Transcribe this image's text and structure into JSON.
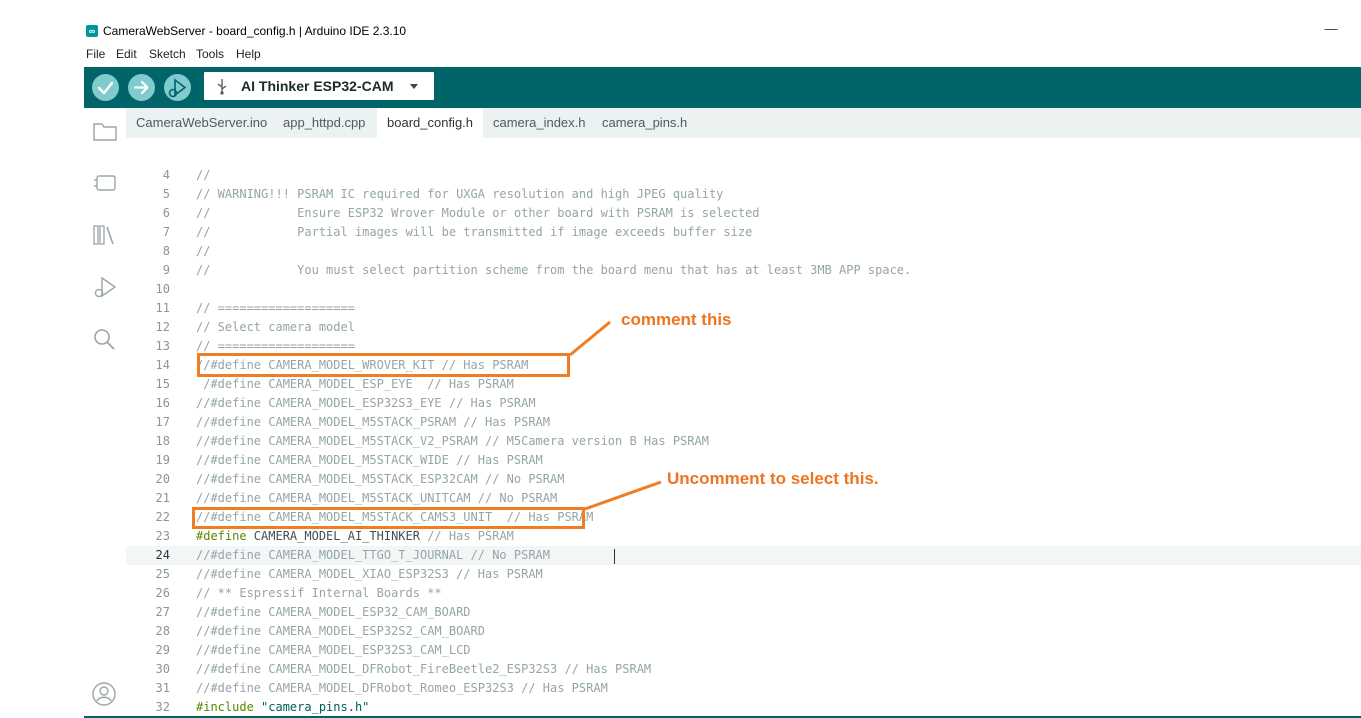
{
  "window": {
    "title": "CameraWebServer - board_config.h | Arduino IDE 2.3.10",
    "minimize_glyph": "—",
    "logo_text": "∞"
  },
  "menu": [
    "File",
    "Edit",
    "Sketch",
    "Tools",
    "Help"
  ],
  "toolbar": {
    "buttons": [
      "verify-button",
      "upload-button",
      "debug-button"
    ],
    "board_name": "AI Thinker ESP32-CAM"
  },
  "sidebar": [
    "folder-icon",
    "board-manager-icon",
    "library-icon",
    "debug-icon",
    "search-icon",
    "account-icon"
  ],
  "tabs": [
    {
      "label": "CameraWebServer.ino",
      "active": false
    },
    {
      "label": "app_httpd.cpp",
      "active": false
    },
    {
      "label": "board_config.h",
      "active": true
    },
    {
      "label": "camera_index.h",
      "active": false
    },
    {
      "label": "camera_pins.h",
      "active": false
    }
  ],
  "editor": {
    "current_line": 24,
    "lines": [
      {
        "n": "4",
        "parts": [
          [
            "c",
            "//"
          ]
        ]
      },
      {
        "n": "5",
        "parts": [
          [
            "c",
            "// WARNING!!! PSRAM IC required for UXGA resolution and high JPEG quality"
          ]
        ]
      },
      {
        "n": "6",
        "parts": [
          [
            "c",
            "//            Ensure ESP32 Wrover Module or other board with PSRAM is selected"
          ]
        ]
      },
      {
        "n": "7",
        "parts": [
          [
            "c",
            "//            Partial images will be transmitted if image exceeds buffer size"
          ]
        ]
      },
      {
        "n": "8",
        "parts": [
          [
            "c",
            "//"
          ]
        ]
      },
      {
        "n": "9",
        "parts": [
          [
            "c",
            "//            You must select partition scheme from the board menu that has at least 3MB APP space."
          ]
        ]
      },
      {
        "n": "10",
        "parts": []
      },
      {
        "n": "11",
        "parts": [
          [
            "c",
            "// ==================="
          ]
        ]
      },
      {
        "n": "12",
        "parts": [
          [
            "c",
            "// Select camera model"
          ]
        ]
      },
      {
        "n": "13",
        "parts": [
          [
            "c",
            "// ==================="
          ]
        ]
      },
      {
        "n": "14",
        "parts": [
          [
            "c",
            "//#define CAMERA_MODEL_WROVER_KIT // Has PSRAM"
          ]
        ]
      },
      {
        "n": "15",
        "parts": [
          [
            "c",
            " /#define CAMERA_MODEL_ESP_EYE  // Has PSRAM"
          ]
        ]
      },
      {
        "n": "16",
        "parts": [
          [
            "c",
            "//#define CAMERA_MODEL_ESP32S3_EYE // Has PSRAM"
          ]
        ]
      },
      {
        "n": "17",
        "parts": [
          [
            "c",
            "//#define CAMERA_MODEL_M5STACK_PSRAM // Has PSRAM"
          ]
        ]
      },
      {
        "n": "18",
        "parts": [
          [
            "c",
            "//#define CAMERA_MODEL_M5STACK_V2_PSRAM // M5Camera version B Has PSRAM"
          ]
        ]
      },
      {
        "n": "19",
        "parts": [
          [
            "c",
            "//#define CAMERA_MODEL_M5STACK_WIDE // Has PSRAM"
          ]
        ]
      },
      {
        "n": "20",
        "parts": [
          [
            "c",
            "//#define CAMERA_MODEL_M5STACK_ESP32CAM // No PSRAM"
          ]
        ]
      },
      {
        "n": "21",
        "parts": [
          [
            "c",
            "//#define CAMERA_MODEL_M5STACK_UNITCAM // No PSRAM"
          ]
        ]
      },
      {
        "n": "22",
        "parts": [
          [
            "c",
            "//#define CAMERA_MODEL_M5STACK_CAMS3_UNIT  // Has PSRAM"
          ]
        ]
      },
      {
        "n": "23",
        "parts": [
          [
            "pp",
            "#define"
          ],
          [
            "plain",
            " CAMERA_MODEL_AI_THINKER "
          ],
          [
            "c",
            "// Has PSRAM"
          ]
        ]
      },
      {
        "n": "24",
        "parts": [
          [
            "c",
            "//#define CAMERA_MODEL_TTGO_T_JOURNAL // No PSRAM"
          ]
        ]
      },
      {
        "n": "25",
        "parts": [
          [
            "c",
            "//#define CAMERA_MODEL_XIAO_ESP32S3 // Has PSRAM"
          ]
        ]
      },
      {
        "n": "26",
        "parts": [
          [
            "c",
            "// ** Espressif Internal Boards **"
          ]
        ]
      },
      {
        "n": "27",
        "parts": [
          [
            "c",
            "//#define CAMERA_MODEL_ESP32_CAM_BOARD"
          ]
        ]
      },
      {
        "n": "28",
        "parts": [
          [
            "c",
            "//#define CAMERA_MODEL_ESP32S2_CAM_BOARD"
          ]
        ]
      },
      {
        "n": "29",
        "parts": [
          [
            "c",
            "//#define CAMERA_MODEL_ESP32S3_CAM_LCD"
          ]
        ]
      },
      {
        "n": "30",
        "parts": [
          [
            "c",
            "//#define CAMERA_MODEL_DFRobot_FireBeetle2_ESP32S3 // Has PSRAM"
          ]
        ]
      },
      {
        "n": "31",
        "parts": [
          [
            "c",
            "//#define CAMERA_MODEL_DFRobot_Romeo_ESP32S3 // Has PSRAM"
          ]
        ]
      },
      {
        "n": "32",
        "parts": [
          [
            "pp",
            "#include"
          ],
          [
            "plain",
            " "
          ],
          [
            "str",
            "\"camera_pins.h\""
          ]
        ]
      },
      {
        "n": "33",
        "parts": []
      }
    ]
  },
  "annotations": {
    "comment_label": "comment this",
    "uncomment_label": "Uncomment to select this.",
    "color": "#f07c24"
  },
  "colors": {
    "accent": "#006468",
    "comment": "#95a5a6",
    "preprocessor": "#5b8800",
    "string": "#005c5f"
  }
}
